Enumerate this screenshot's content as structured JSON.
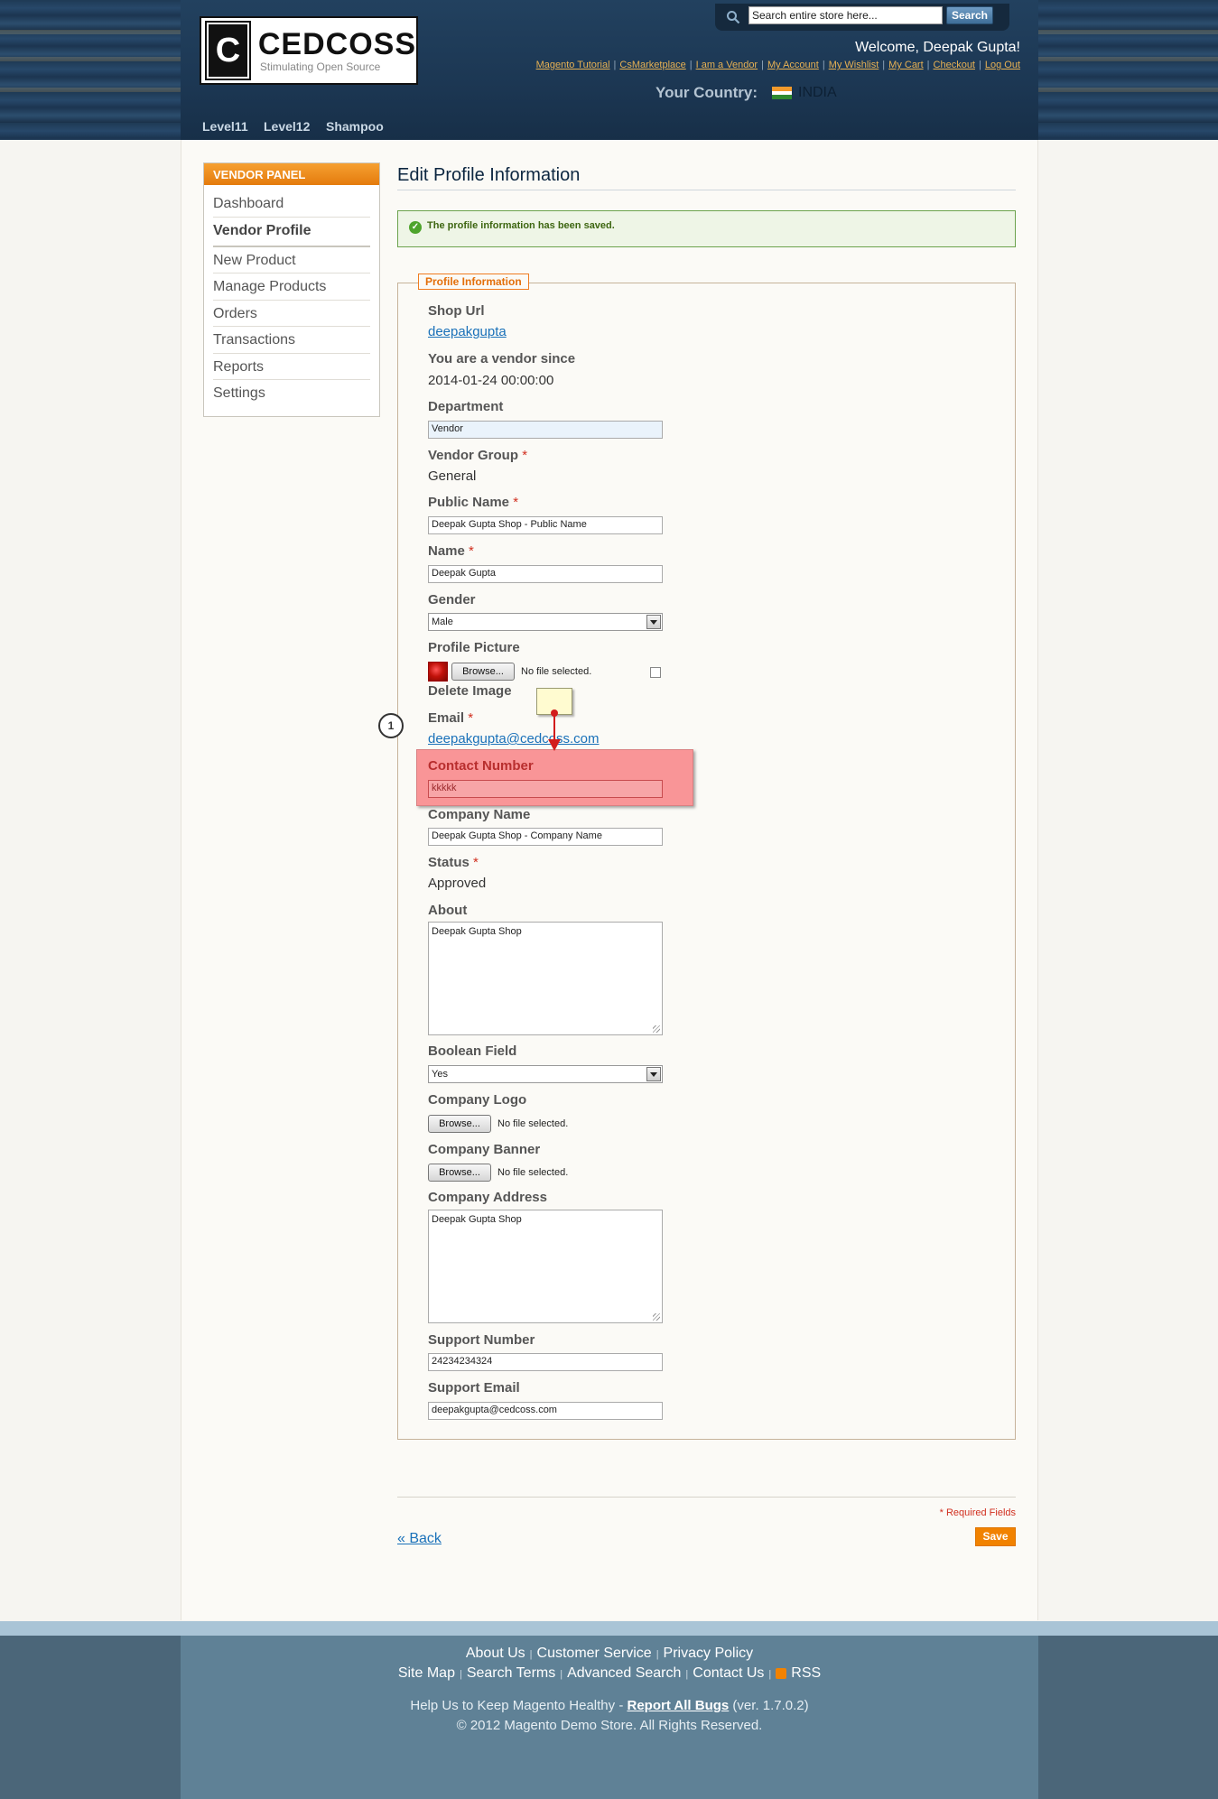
{
  "header": {
    "logo_name": "CEDCOSS",
    "logo_tagline": "Stimulating Open Source",
    "logo_mark": "C",
    "search_placeholder": "Search entire store here...",
    "search_button": "Search",
    "welcome": "Welcome, Deepak Gupta!",
    "links": [
      "Magento Tutorial",
      "CsMarketplace",
      "I am a Vendor",
      "My Account",
      "My Wishlist",
      "My Cart",
      "Checkout",
      "Log Out"
    ],
    "country_label": "Your Country:",
    "country_name": "INDIA",
    "nav": [
      "Level11",
      "Level12",
      "Shampoo"
    ]
  },
  "sidebar": {
    "title": "VENDOR PANEL",
    "items": [
      "Dashboard",
      "Vendor Profile",
      "New Product",
      "Manage Products",
      "Orders",
      "Transactions",
      "Reports",
      "Settings"
    ],
    "active": "Vendor Profile"
  },
  "page": {
    "title": "Edit Profile Information",
    "success_message": "The profile information has been saved.",
    "legend": "Profile Information"
  },
  "form": {
    "shop_url_label": "Shop Url",
    "shop_url_value": "deepakgupta",
    "vendor_since_label": "You are a vendor since",
    "vendor_since_value": "2014-01-24 00:00:00",
    "department_label": "Department",
    "department_value": "Vendor",
    "vendor_group_label": "Vendor Group",
    "vendor_group_value": "General",
    "public_name_label": "Public Name",
    "public_name_value": "Deepak Gupta Shop - Public Name",
    "name_label": "Name",
    "name_value": "Deepak Gupta",
    "gender_label": "Gender",
    "gender_value": "Male",
    "profile_picture_label": "Profile Picture",
    "browse_label": "Browse...",
    "no_file": "No file selected.",
    "delete_image_label": "Delete Image",
    "email_label": "Email",
    "email_value": "deepakgupta@cedcoss.com",
    "contact_number_label": "Contact Number",
    "contact_number_value": "kkkkk",
    "company_name_label": "Company Name",
    "company_name_value": "Deepak Gupta Shop - Company Name",
    "status_label": "Status",
    "status_value": "Approved",
    "about_label": "About",
    "about_value": "Deepak Gupta Shop",
    "boolean_field_label": "Boolean Field",
    "boolean_field_value": "Yes",
    "company_logo_label": "Company Logo",
    "company_banner_label": "Company Banner",
    "company_address_label": "Company Address",
    "company_address_value": "Deepak Gupta Shop",
    "support_number_label": "Support Number",
    "support_number_value": "24234234324",
    "support_email_label": "Support Email",
    "support_email_value": "deepakgupta@cedcoss.com",
    "required_star": "*"
  },
  "annotation": {
    "marker_number": "1"
  },
  "actions": {
    "required_fields": "* Required Fields",
    "back": "« Back",
    "save": "Save"
  },
  "footer": {
    "row1": [
      "About Us",
      "Customer Service",
      "Privacy Policy"
    ],
    "row2": [
      "Site Map",
      "Search Terms",
      "Advanced Search",
      "Contact Us",
      "RSS"
    ],
    "help_prefix": "Help Us to Keep Magento Healthy - ",
    "help_link": "Report All Bugs",
    "help_suffix": " (ver. 1.7.0.2)",
    "copyright": "© 2012 Magento Demo Store. All Rights Reserved."
  },
  "colors": {
    "accent_orange": "#f18200",
    "header_navy": "#1e3a55",
    "error_red": "#f99597",
    "link_blue": "#1a71b9"
  }
}
